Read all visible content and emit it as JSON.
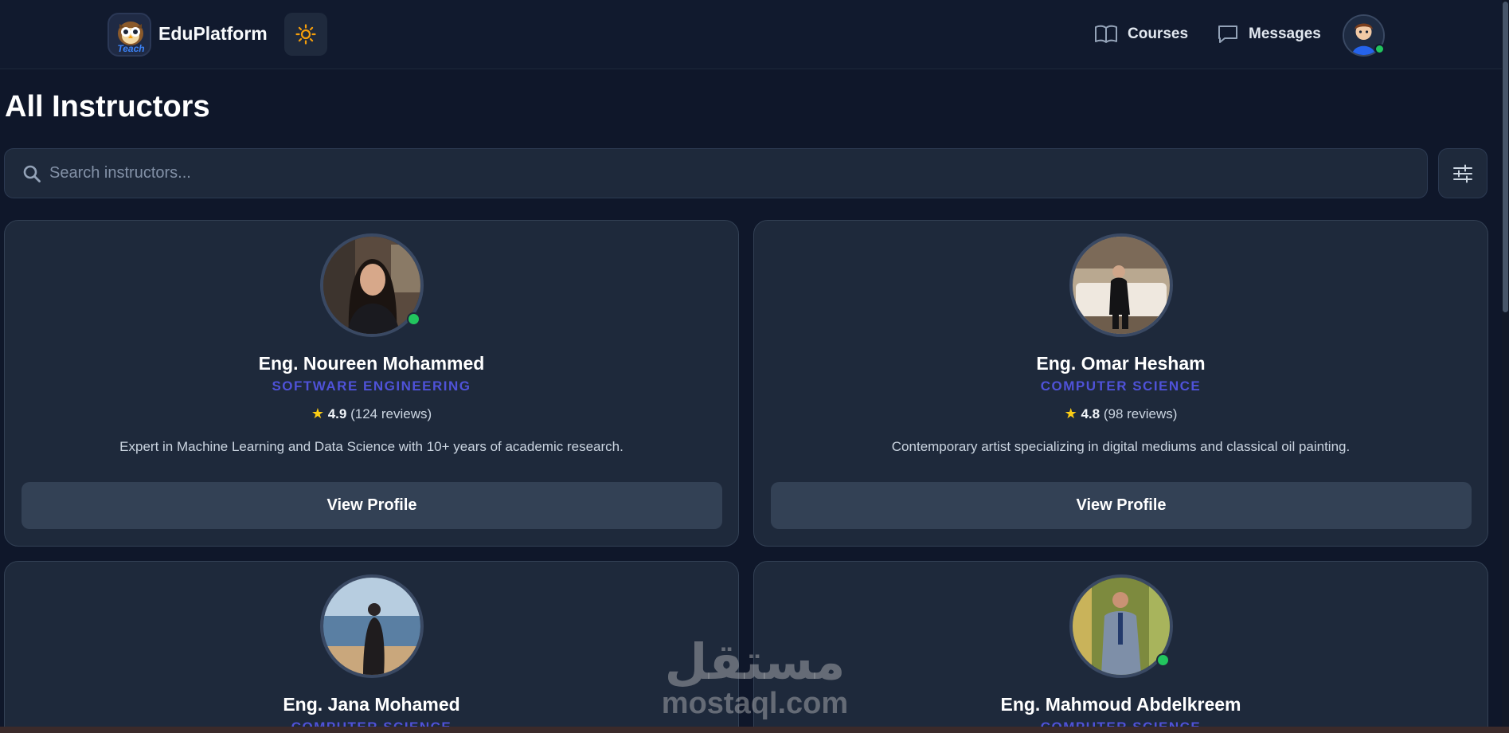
{
  "header": {
    "brand": "EduPlatform",
    "logo_text": "Teach",
    "nav": [
      {
        "label": "Courses",
        "icon": "book-open-icon"
      },
      {
        "label": "Messages",
        "icon": "message-square-icon"
      }
    ],
    "theme_icon": "sun-icon"
  },
  "page": {
    "title": "All Instructors"
  },
  "search": {
    "placeholder": "Search instructors...",
    "value": ""
  },
  "instructors": [
    {
      "name": "Eng. Noureen Mohammed",
      "department": "SOFTWARE ENGINEERING",
      "rating": "4.9",
      "reviews": "(124 reviews)",
      "bio": "Expert in Machine Learning and Data Science with 10+ years of academic research.",
      "online": true,
      "button": "View Profile"
    },
    {
      "name": "Eng. Omar Hesham",
      "department": "COMPUTER SCIENCE",
      "rating": "4.8",
      "reviews": "(98 reviews)",
      "bio": "Contemporary artist specializing in digital mediums and classical oil painting.",
      "online": false,
      "button": "View Profile"
    },
    {
      "name": "Eng. Jana Mohamed",
      "department": "COMPUTER SCIENCE",
      "online": false
    },
    {
      "name": "Eng. Mahmoud Abdelkreem",
      "department": "COMPUTER SCIENCE",
      "online": true
    }
  ],
  "watermark": {
    "arabic": "مستقل",
    "latin": "mostaql.com"
  },
  "colors": {
    "background": "#0f172a",
    "card": "#1e293b",
    "accent": "#4f52d8",
    "online": "#22c55e",
    "star": "#facc15"
  }
}
